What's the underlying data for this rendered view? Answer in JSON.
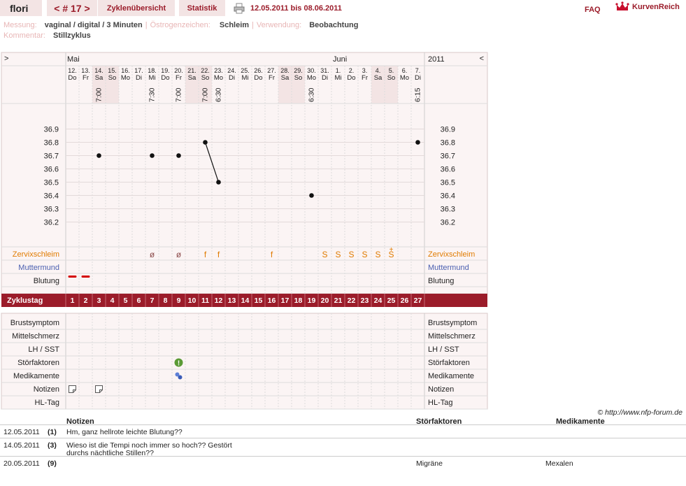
{
  "header": {
    "user": "flori",
    "cycle_nav": "< # 17 >",
    "tab_overview": "Zyklenübersicht",
    "tab_stats": "Statistik",
    "date_range": "12.05.2011 bis 08.06.2011",
    "faq": "FAQ",
    "brand": "KurvenReich"
  },
  "meta": {
    "messung_label": "Messung:",
    "messung_value": "vaginal / digital / 3 Minuten",
    "oestrogen_label": "Östrogenzeichen:",
    "oestrogen_value": "Schleim",
    "verwendung_label": "Verwendung:",
    "verwendung_value": "Beobachtung",
    "kommentar_label": "Kommentar:",
    "kommentar_value": "Stillzyklus"
  },
  "chart_data": {
    "type": "line",
    "nav_left": ">",
    "nav_right": "<",
    "year": "2011",
    "months": [
      {
        "label": "Mai",
        "col": 0
      },
      {
        "label": "Juni",
        "col": 20
      }
    ],
    "days": [
      {
        "d": "12.",
        "w": "Do",
        "time": "",
        "we": false
      },
      {
        "d": "13.",
        "w": "Fr",
        "time": "",
        "we": false
      },
      {
        "d": "14.",
        "w": "Sa",
        "time": "7:00",
        "we": true
      },
      {
        "d": "15.",
        "w": "So",
        "time": "",
        "we": true
      },
      {
        "d": "16.",
        "w": "Mo",
        "time": "",
        "we": false
      },
      {
        "d": "17.",
        "w": "Di",
        "time": "",
        "we": false
      },
      {
        "d": "18.",
        "w": "Mi",
        "time": "7:30",
        "we": false
      },
      {
        "d": "19.",
        "w": "Do",
        "time": "",
        "we": false
      },
      {
        "d": "20.",
        "w": "Fr",
        "time": "7:00",
        "we": false
      },
      {
        "d": "21.",
        "w": "Sa",
        "time": "",
        "we": true
      },
      {
        "d": "22.",
        "w": "So",
        "time": "7:00",
        "we": true
      },
      {
        "d": "23.",
        "w": "Mo",
        "time": "6:30",
        "we": false
      },
      {
        "d": "24.",
        "w": "Di",
        "time": "",
        "we": false
      },
      {
        "d": "25.",
        "w": "Mi",
        "time": "",
        "we": false
      },
      {
        "d": "26.",
        "w": "Do",
        "time": "",
        "we": false
      },
      {
        "d": "27.",
        "w": "Fr",
        "time": "",
        "we": false
      },
      {
        "d": "28.",
        "w": "Sa",
        "time": "",
        "we": true
      },
      {
        "d": "29.",
        "w": "So",
        "time": "",
        "we": true
      },
      {
        "d": "30.",
        "w": "Mo",
        "time": "6:30",
        "we": false
      },
      {
        "d": "31.",
        "w": "Di",
        "time": "",
        "we": false
      },
      {
        "d": "1.",
        "w": "Mi",
        "time": "",
        "we": false
      },
      {
        "d": "2.",
        "w": "Do",
        "time": "",
        "we": false
      },
      {
        "d": "3.",
        "w": "Fr",
        "time": "",
        "we": false
      },
      {
        "d": "4.",
        "w": "Sa",
        "time": "",
        "we": true
      },
      {
        "d": "5.",
        "w": "So",
        "time": "",
        "we": true
      },
      {
        "d": "6.",
        "w": "Mo",
        "time": "",
        "we": false
      },
      {
        "d": "7.",
        "w": "Di",
        "time": "6:15",
        "we": false
      }
    ],
    "y_ticks": [
      "36.9",
      "36.8",
      "36.7",
      "36.6",
      "36.5",
      "36.4",
      "36.3",
      "36.2"
    ],
    "ylim": [
      36.2,
      36.9
    ],
    "temperatures": [
      {
        "day": 3,
        "value": 36.7
      },
      {
        "day": 7,
        "value": 36.7
      },
      {
        "day": 9,
        "value": 36.7
      },
      {
        "day": 11,
        "value": 36.8
      },
      {
        "day": 12,
        "value": 36.5
      },
      {
        "day": 19,
        "value": 36.4
      },
      {
        "day": 27,
        "value": 36.8
      }
    ],
    "connected_segments": [
      [
        11,
        12
      ]
    ],
    "rows": {
      "zervix": "Zervixschleim",
      "muttermund": "Muttermund",
      "blutung": "Blutung",
      "zyklustag": "Zyklustag",
      "brust": "Brustsymptom",
      "mittel": "Mittelschmerz",
      "lh": "LH / SST",
      "stoer": "Störfaktoren",
      "medi": "Medikamente",
      "notizen": "Notizen",
      "hl": "HL-Tag"
    },
    "zervix_marks": [
      {
        "day": 7,
        "sym": "ø",
        "color": "#8b4a4a"
      },
      {
        "day": 9,
        "sym": "ø",
        "color": "#8b4a4a"
      },
      {
        "day": 11,
        "sym": "f",
        "color": "#e07b00"
      },
      {
        "day": 12,
        "sym": "f",
        "color": "#e07b00"
      },
      {
        "day": 16,
        "sym": "f",
        "color": "#e07b00"
      },
      {
        "day": 20,
        "sym": "S",
        "color": "#e07b00"
      },
      {
        "day": 21,
        "sym": "S",
        "color": "#e07b00"
      },
      {
        "day": 22,
        "sym": "S",
        "color": "#e07b00"
      },
      {
        "day": 23,
        "sym": "S",
        "color": "#e07b00"
      },
      {
        "day": 24,
        "sym": "S",
        "color": "#e07b00"
      },
      {
        "day": 25,
        "sym": "S",
        "color": "#e07b00",
        "plus": "+"
      }
    ],
    "blutung_days": [
      1,
      2
    ],
    "stoer_days": [
      9
    ],
    "medi_days": [
      9
    ],
    "notiz_days": [
      1,
      3
    ],
    "copyright": "© http://www.nfp-forum.de"
  },
  "notes": {
    "headers": {
      "notizen": "Notizen",
      "stoer": "Störfaktoren",
      "medi": "Medikamente"
    },
    "rows": [
      {
        "date": "12.05.2011",
        "num": "(1)",
        "text1": "Hm, ganz hellrote leichte Blutung??",
        "text2": "",
        "stoer": "",
        "medi": ""
      },
      {
        "date": "14.05.2011",
        "num": "(3)",
        "text1": "Wieso ist die Tempi noch immer so hoch?? Gestört",
        "text2": "durchs nächtliche Stillen??",
        "stoer": "",
        "medi": ""
      },
      {
        "date": "20.05.2011",
        "num": "(9)",
        "text1": "",
        "text2": "",
        "stoer": "Migräne",
        "medi": "Mexalen"
      }
    ]
  },
  "colors": {
    "accent": "#9b1c2a",
    "weekend": "#f3e4e4",
    "grid": "#dcdcdc",
    "zervix": "#e07b00",
    "muttermund": "#4a5fb0"
  }
}
